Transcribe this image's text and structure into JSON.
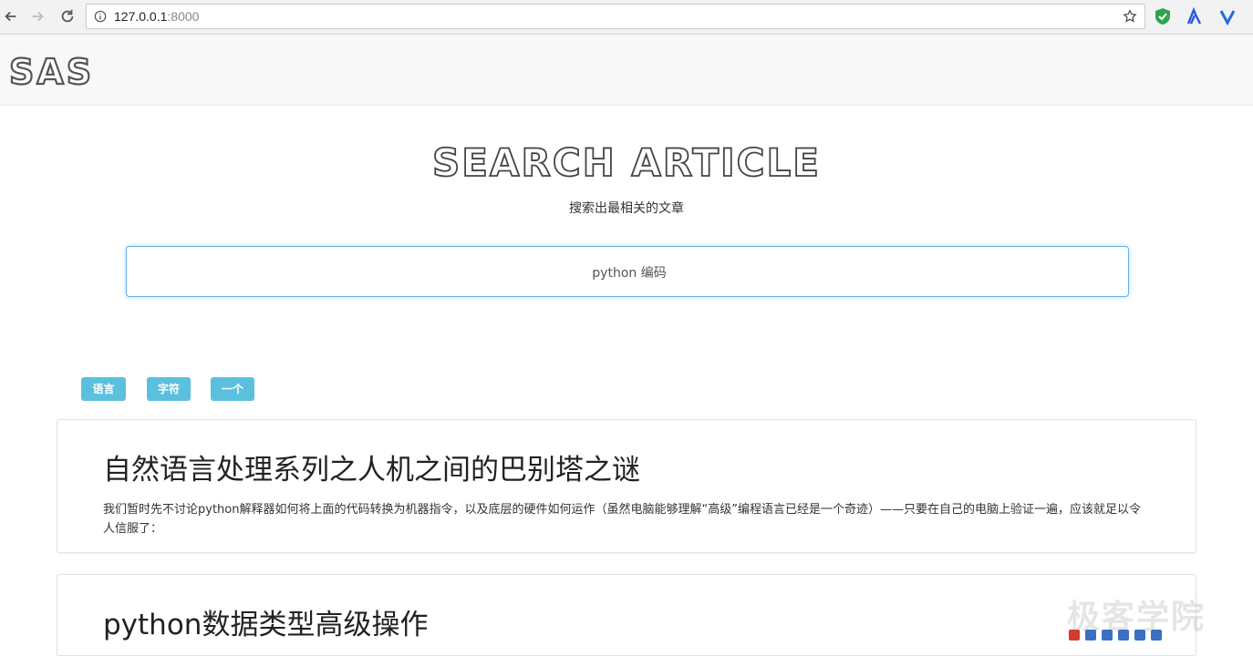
{
  "browser": {
    "url_host": "127.0.0.1",
    "url_port": ":8000"
  },
  "header": {
    "logo": "SAS"
  },
  "hero": {
    "title": "SEARCH ARTICLE",
    "subtitle": "搜索出最相关的文章"
  },
  "search": {
    "value": "python 编码"
  },
  "tags": [
    "语言",
    "字符",
    "一个"
  ],
  "results": [
    {
      "title": "自然语言处理系列之人机之间的巴别塔之谜",
      "snippet": "我们暂时先不讨论python解释器如何将上面的代码转换为机器指令，以及底层的硬件如何运作（虽然电脑能够理解“高级”编程语言已经是一个奇迹）——只要在自己的电脑上验证一遍，应该就足以令人信服了："
    },
    {
      "title": "python数据类型高级操作",
      "snippet": ""
    }
  ],
  "watermark": "极客学院",
  "icons": {
    "back": "arrow-left-icon",
    "forward": "arrow-right-icon",
    "reload": "reload-icon",
    "info": "info-icon",
    "bookmark": "star-icon",
    "ext1": "shield-icon",
    "ext2": "lambda-icon",
    "ext3": "v-icon"
  },
  "colors": {
    "tag": "#5bc0de",
    "search_focus": "#66afe9"
  }
}
